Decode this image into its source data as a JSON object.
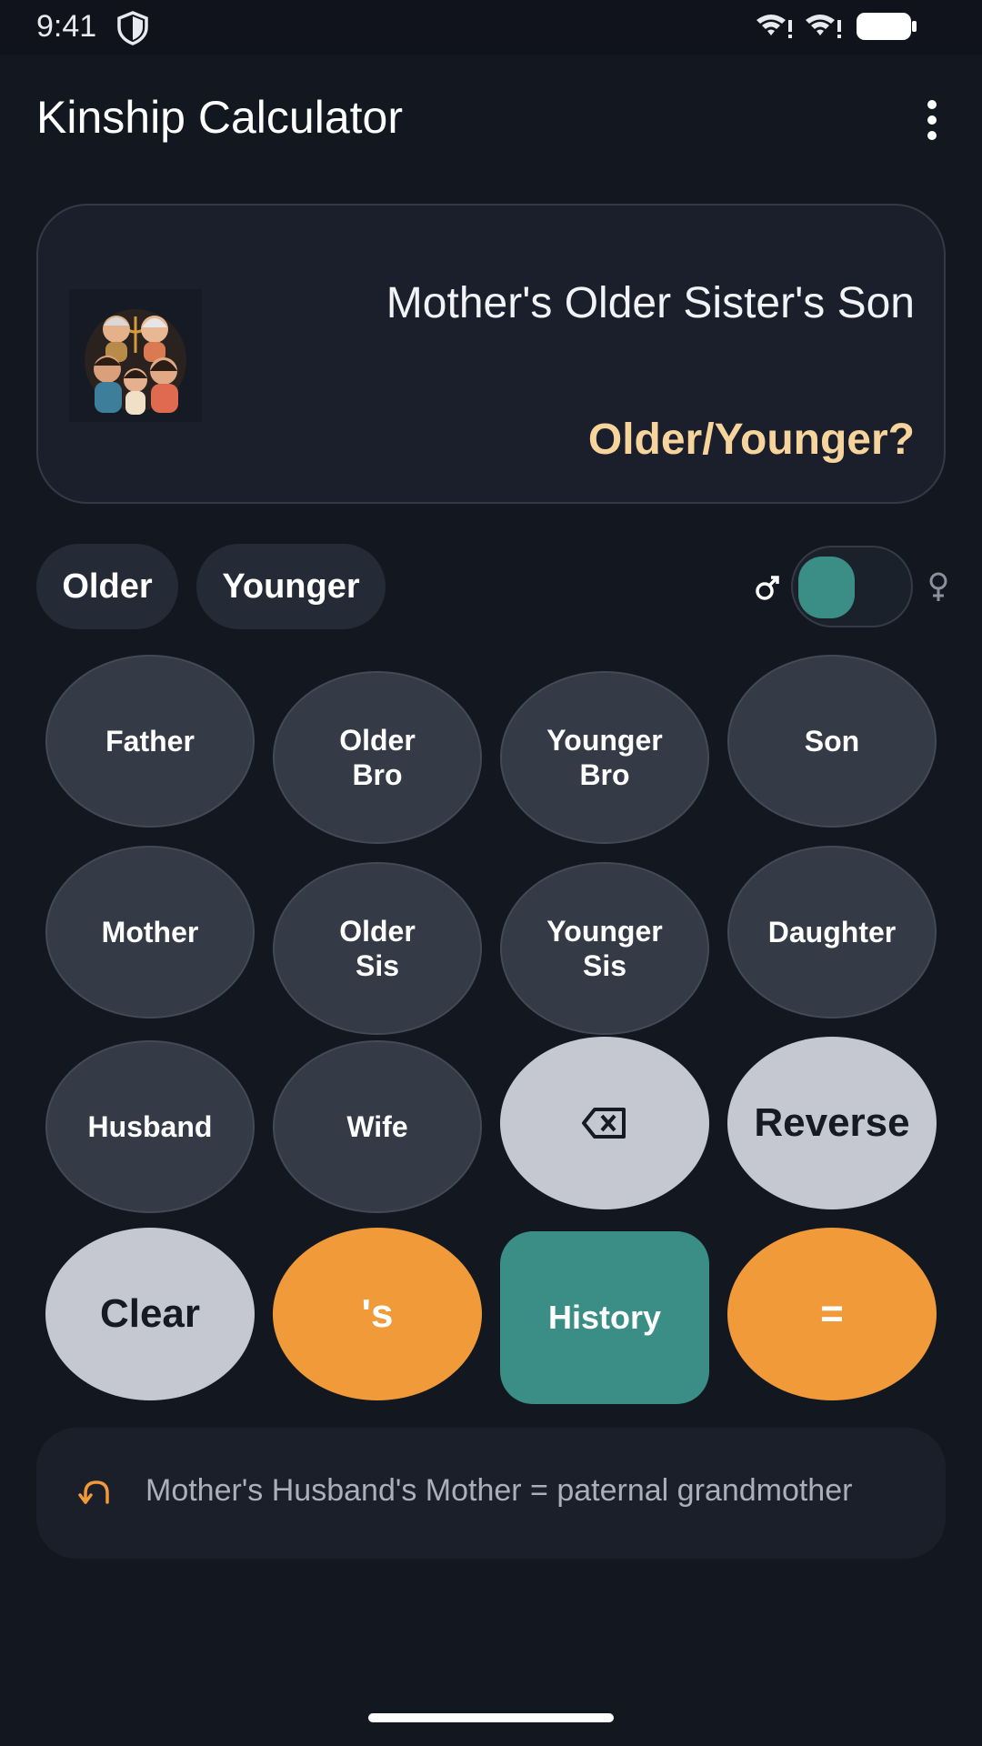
{
  "status_bar": {
    "time": "9:41",
    "icons": [
      "shield-icon",
      "wifi-icon",
      "wifi-icon",
      "battery-icon"
    ]
  },
  "app_bar": {
    "title": "Kinship Calculator",
    "menu_icon": "more-vert-icon"
  },
  "display": {
    "expression": "Mother's Older Sister's Son",
    "hint": "Older/Younger?",
    "hint_color": "#f7d49c"
  },
  "chips": {
    "older": "Older",
    "younger": "Younger"
  },
  "gender_toggle": {
    "male_symbol": "♂",
    "female_symbol": "♀",
    "selected": "male",
    "accent": "#3a8e86"
  },
  "keypad": {
    "father": "Father",
    "older_bro": "Older\nBro",
    "younger_bro": "Younger\nBro",
    "son": "Son",
    "mother": "Mother",
    "older_sis": "Older\nSis",
    "younger_sis": "Younger\nSis",
    "daughter": "Daughter",
    "husband": "Husband",
    "wife": "Wife",
    "backspace_icon": "backspace-icon",
    "reverse": "Reverse",
    "clear": "Clear",
    "possessive": "'s",
    "history": "History",
    "equals": "="
  },
  "colors": {
    "orange": "#f19a39",
    "teal": "#3a8e86",
    "light_key": "#c5c8d1",
    "dark_key": "#343a46"
  },
  "history_bar": {
    "icon": "undo-icon",
    "text": "Mother's Husband's Mother = paternal grandmother"
  }
}
